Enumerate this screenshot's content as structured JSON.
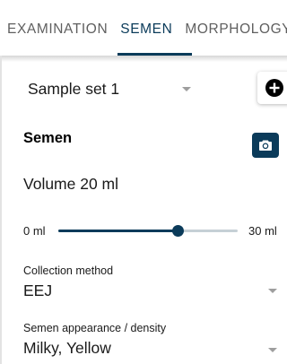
{
  "tabs": [
    {
      "label": "EXAMINATION",
      "active": false
    },
    {
      "label": "SEMEN",
      "active": true
    },
    {
      "label": "MORPHOLOGY",
      "active": false
    }
  ],
  "sample_set": {
    "value": "Sample set 1",
    "add_icon": "add-circle-icon"
  },
  "section": {
    "title": "Semen",
    "camera_icon": "camera-icon"
  },
  "volume": {
    "label": "Volume 20 ml",
    "value_ml": 20,
    "min_label": "0 ml",
    "max_label": "30 ml",
    "min": 0,
    "max": 30
  },
  "fields": [
    {
      "label": "Collection method",
      "value": "EEJ"
    },
    {
      "label": "Semen appearance / density",
      "value": "Milky, Yellow"
    }
  ],
  "colors": {
    "accent": "#0b3b5a",
    "tab_inactive": "#5f5f5f",
    "track": "#c6d0d6",
    "caret": "#9e9e9e"
  }
}
